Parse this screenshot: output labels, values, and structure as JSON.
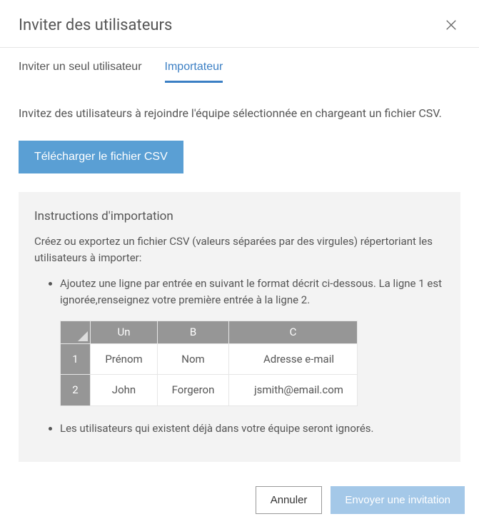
{
  "header": {
    "title": "Inviter des utilisateurs"
  },
  "tabs": {
    "single": "Inviter un seul utilisateur",
    "import": "Importateur"
  },
  "content": {
    "intro": "Invitez des utilisateurs à rejoindre l'équipe sélectionnée en chargeant un fichier CSV.",
    "download_button": "Télécharger le fichier CSV"
  },
  "instructions": {
    "title": "Instructions d'importation",
    "desc": "Créez ou exportez un fichier CSV (valeurs séparées par des virgules) répertoriant les utilisateurs à importer:",
    "step1": "Ajoutez une ligne par entrée en suivant le format décrit ci-dessous. La ligne 1 est ignorée,renseignez votre première entrée à la ligne 2.",
    "step2": "Les utilisateurs qui existent déjà dans votre équipe seront ignorés."
  },
  "table": {
    "cols": {
      "a": "Un",
      "b": "B",
      "c": "C"
    },
    "rows": [
      {
        "n": "1",
        "a": "Prénom",
        "b": "Nom",
        "c": "Adresse e-mail"
      },
      {
        "n": "2",
        "a": "John",
        "b": "Forgeron",
        "c": "jsmith@email.com"
      }
    ]
  },
  "footer": {
    "cancel": "Annuler",
    "send": "Envoyer une invitation"
  }
}
